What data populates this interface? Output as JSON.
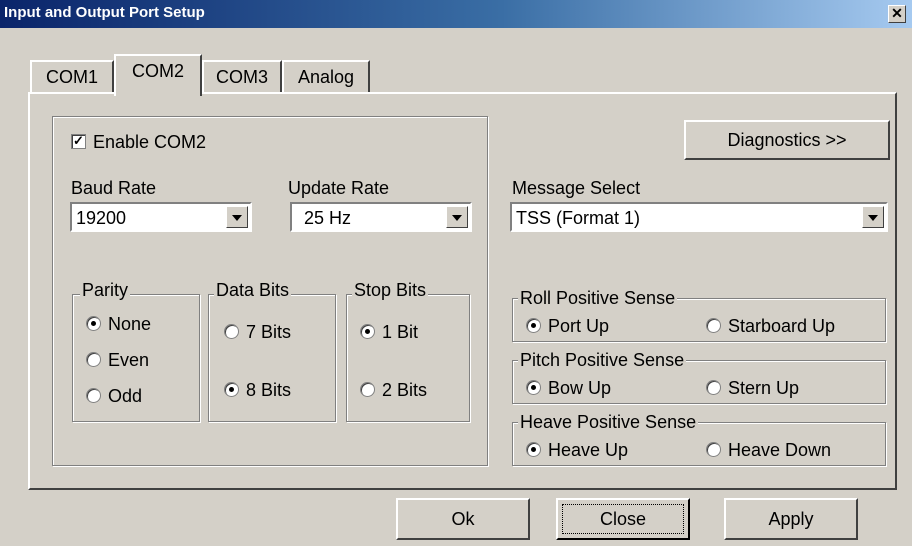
{
  "window": {
    "title": "Input and Output Port Setup",
    "close_glyph": "✕"
  },
  "tabs": [
    "COM1",
    "COM2",
    "COM3",
    "Analog"
  ],
  "active_tab": "COM2",
  "port": {
    "enable_label": "Enable COM2",
    "enable_checked": true,
    "check_glyph": "✓",
    "baud_label": "Baud Rate",
    "baud_value": "19200",
    "update_label": "Update Rate",
    "update_value": "25 Hz",
    "parity": {
      "legend": "Parity",
      "options": [
        "None",
        "Even",
        "Odd"
      ],
      "selected": "None"
    },
    "data_bits": {
      "legend": "Data Bits",
      "options": [
        "7 Bits",
        "8 Bits"
      ],
      "selected": "8 Bits"
    },
    "stop_bits": {
      "legend": "Stop Bits",
      "options": [
        "1 Bit",
        "2 Bits"
      ],
      "selected": "1 Bit"
    }
  },
  "diagnostics_label": "Diagnostics >>",
  "message": {
    "label": "Message Select",
    "value": "TSS (Format 1)"
  },
  "roll": {
    "legend": "Roll Positive Sense",
    "options": [
      "Port Up",
      "Starboard Up"
    ],
    "selected": "Port Up"
  },
  "pitch": {
    "legend": "Pitch Positive Sense",
    "options": [
      "Bow Up",
      "Stern Up"
    ],
    "selected": "Bow Up"
  },
  "heave": {
    "legend": "Heave Positive Sense",
    "options": [
      "Heave Up",
      "Heave Down"
    ],
    "selected": "Heave Up"
  },
  "buttons": {
    "ok": "Ok",
    "close": "Close",
    "apply": "Apply"
  }
}
